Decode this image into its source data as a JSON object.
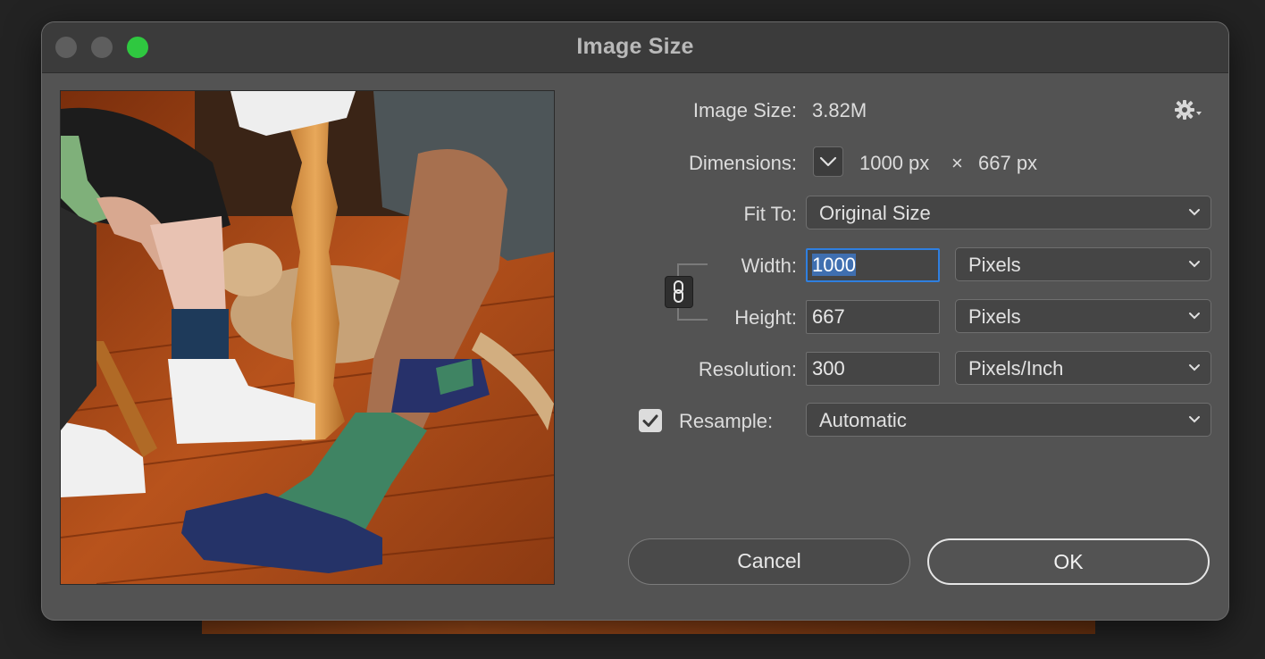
{
  "window": {
    "title": "Image Size"
  },
  "image_size": {
    "label": "Image Size:",
    "value": "3.82M"
  },
  "dimensions": {
    "label": "Dimensions:",
    "width_value": "1000 px",
    "times": "×",
    "height_value": "667 px"
  },
  "fit_to": {
    "label": "Fit To:",
    "selected": "Original Size"
  },
  "width": {
    "label": "Width:",
    "value": "1000",
    "unit": "Pixels"
  },
  "height": {
    "label": "Height:",
    "value": "667",
    "unit": "Pixels"
  },
  "resolution": {
    "label": "Resolution:",
    "value": "300",
    "unit": "Pixels/Inch"
  },
  "resample": {
    "label": "Resample:",
    "checked": true,
    "selected": "Automatic"
  },
  "buttons": {
    "cancel": "Cancel",
    "ok": "OK"
  },
  "icons": {
    "gear": "gear-icon",
    "chain": "chain-link-icon",
    "chevron": "chevron-down-icon",
    "check": "check-icon"
  },
  "colors": {
    "dialog_bg": "#535353",
    "titlebar_bg": "#3b3b3b",
    "focus_blue": "#2f7fe0",
    "traffic_green": "#2fc840"
  }
}
